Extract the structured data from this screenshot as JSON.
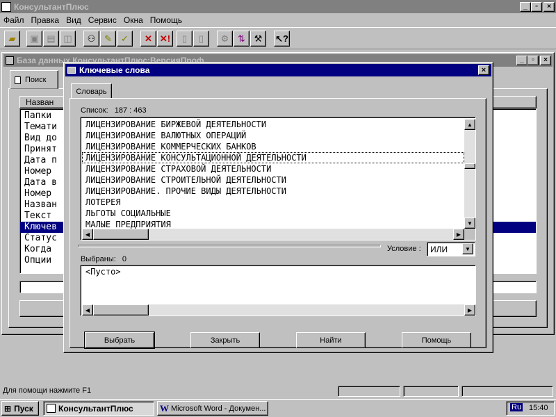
{
  "app": {
    "title": "КонсультантПлюс",
    "min": "_",
    "restore": "▫",
    "close": "×"
  },
  "menu": [
    "Файл",
    "Правка",
    "Вид",
    "Сервис",
    "Окна",
    "Помощь"
  ],
  "toolbar_icons": [
    "open-icon",
    "save-icon",
    "print-icon",
    "preview-icon",
    "binoculars-icon",
    "edit-list-icon",
    "check-list-icon",
    "delete-icon",
    "delete-all-icon",
    "document-icon",
    "document-edit-icon",
    "network-icon",
    "sort-icon",
    "tools-icon",
    "help-pointer-icon"
  ],
  "bgwin": {
    "title": "База данных КонсультантПлюс:ВерсияПроф",
    "tab_label": "Поиск",
    "list_header": "Назван",
    "rows": [
      "Папки",
      "Темати",
      "Вид до",
      "Принят",
      "Дата п",
      "Номер",
      "Дата в",
      "Номер",
      "Назван",
      "Текст",
      "Ключев",
      "Статус",
      "Когда",
      "Опции"
    ],
    "selected_index": 10
  },
  "dialog": {
    "title": "Ключевые слова",
    "tab_label": "Словарь",
    "list_label": "Список:",
    "list_count": "187 : 463",
    "items": [
      "ЛИЦЕНЗИРОВАНИЕ БИРЖЕВОЙ ДЕЯТЕЛЬНОСТИ",
      "ЛИЦЕНЗИРОВАНИЕ ВАЛЮТНЫХ ОПЕРАЦИЙ",
      "ЛИЦЕНЗИРОВАНИЕ КОММЕРЧЕСКИХ БАНКОВ",
      "ЛИЦЕНЗИРОВАНИЕ КОНСУЛЬТАЦИОННОЙ ДЕЯТЕЛЬНОСТИ",
      "ЛИЦЕНЗИРОВАНИЕ СТРАХОВОЙ ДЕЯТЕЛЬНОСТИ",
      "ЛИЦЕНЗИРОВАНИЕ СТРОИТЕЛЬНОЙ ДЕЯТЕЛЬНОСТИ",
      "ЛИЦЕНЗИРОВАНИЕ. ПРОЧИЕ ВИДЫ ДЕЯТЕЛЬНОСТИ",
      "ЛОТЕРЕЯ",
      "ЛЬГОТЫ СОЦИАЛЬНЫЕ",
      "МАЛЫЕ ПРЕДПРИЯТИЯ"
    ],
    "focused_index": 3,
    "condition_label": "Условие :",
    "condition_value": "ИЛИ",
    "selected_label": "Выбраны:",
    "selected_count": "0",
    "selected_empty": "<Пусто>",
    "buttons": {
      "select": "Выбрать",
      "close": "Закрыть",
      "find": "Найти",
      "help": "Помощь"
    }
  },
  "status": {
    "text": "Для помощи нажмите F1"
  },
  "taskbar": {
    "start": "Пуск",
    "tasks": [
      "КонсультантПлюс",
      "Microsoft Word - Докумен..."
    ],
    "lang": "Ru",
    "clock": "15:40"
  },
  "colors": {
    "selection": "#000080",
    "face": "#c0c0c0",
    "desktop": "#808080"
  }
}
